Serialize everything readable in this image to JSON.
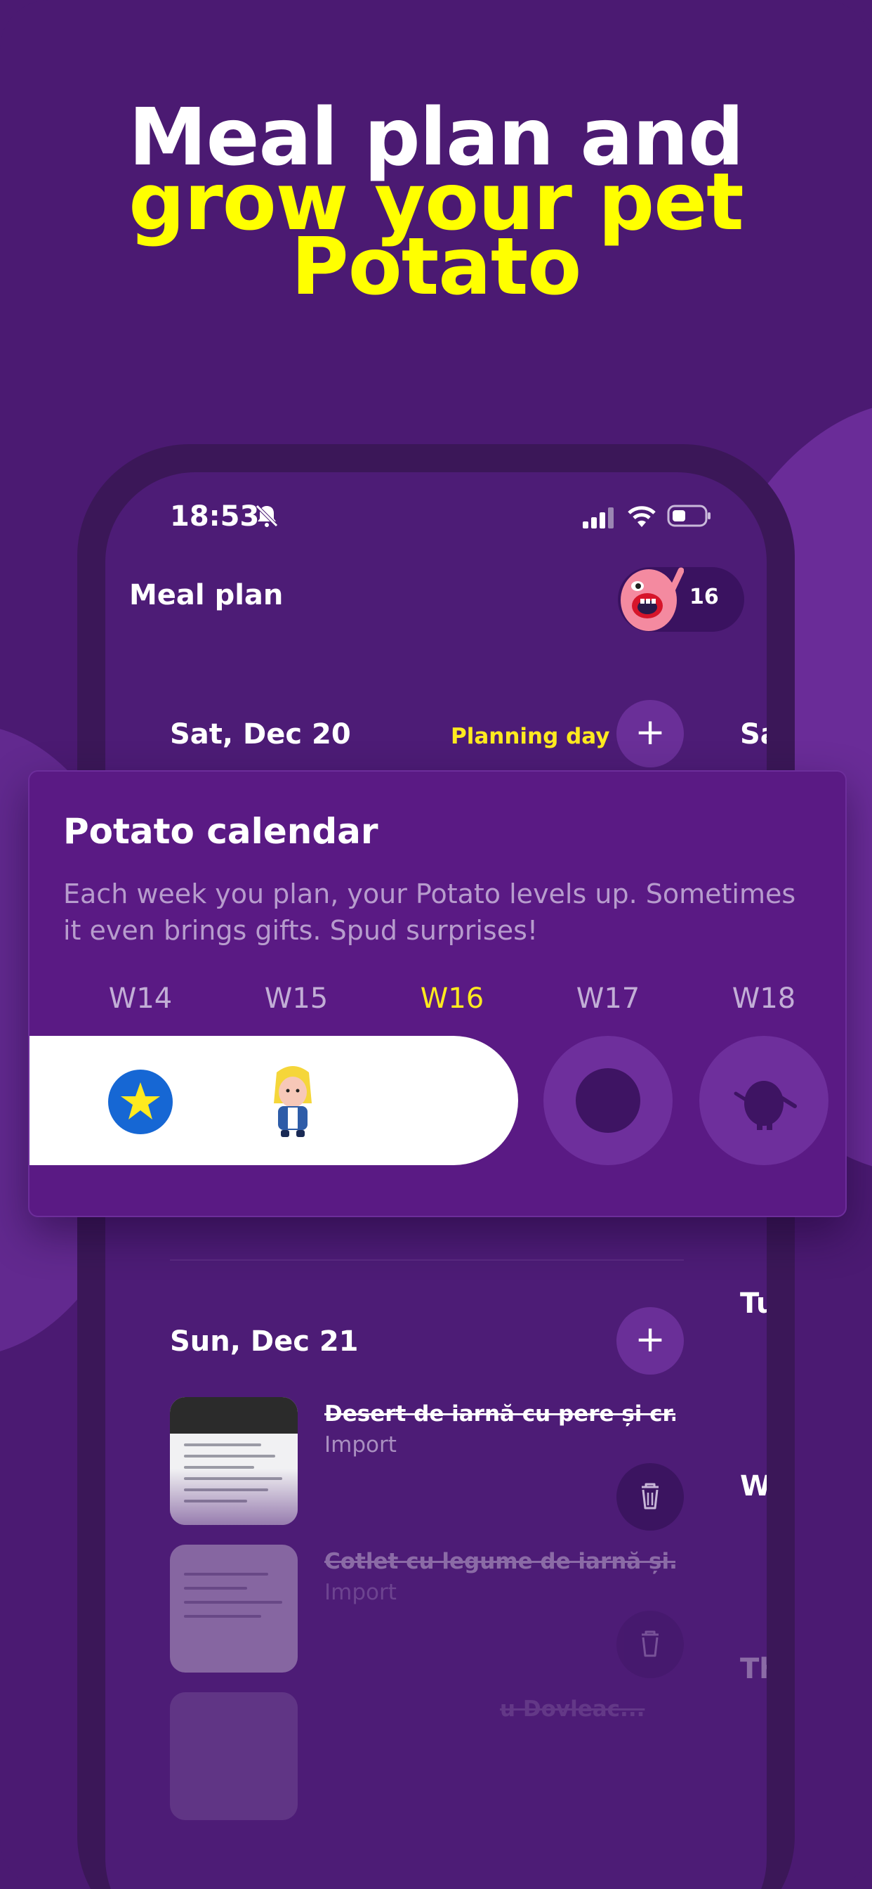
{
  "headline": {
    "line1": "Meal plan and",
    "line2": "grow your pet",
    "line3": "Potato"
  },
  "status_bar": {
    "time": "18:53"
  },
  "app": {
    "title": "Meal plan",
    "pet_level": "16"
  },
  "days": [
    {
      "label": "Sat, Dec 20",
      "badge": "Planning day",
      "next_peek": "Sa"
    },
    {
      "label": "Sun, Dec 21",
      "prev_peek_1": "Tu",
      "prev_peek_2": "W",
      "prev_peek_3": "Th"
    }
  ],
  "meals": [
    {
      "title": "Desert de iarnă cu pere și cr...",
      "source": "Import"
    },
    {
      "title": "Cotlet cu legume de iarnă și...",
      "source": "Import"
    },
    {
      "title": "u Dovleac..."
    }
  ],
  "calendar_card": {
    "title": "Potato calendar",
    "description": "Each week you plan, your Potato levels up. Sometimes it even brings gifts. Spud surprises!",
    "weeks": [
      "W14",
      "W15",
      "W16",
      "W17",
      "W18"
    ],
    "current_week": "W16"
  },
  "colors": {
    "background": "#4b1a72",
    "accent_yellow": "#ffea1f",
    "card": "#5a1a84"
  }
}
